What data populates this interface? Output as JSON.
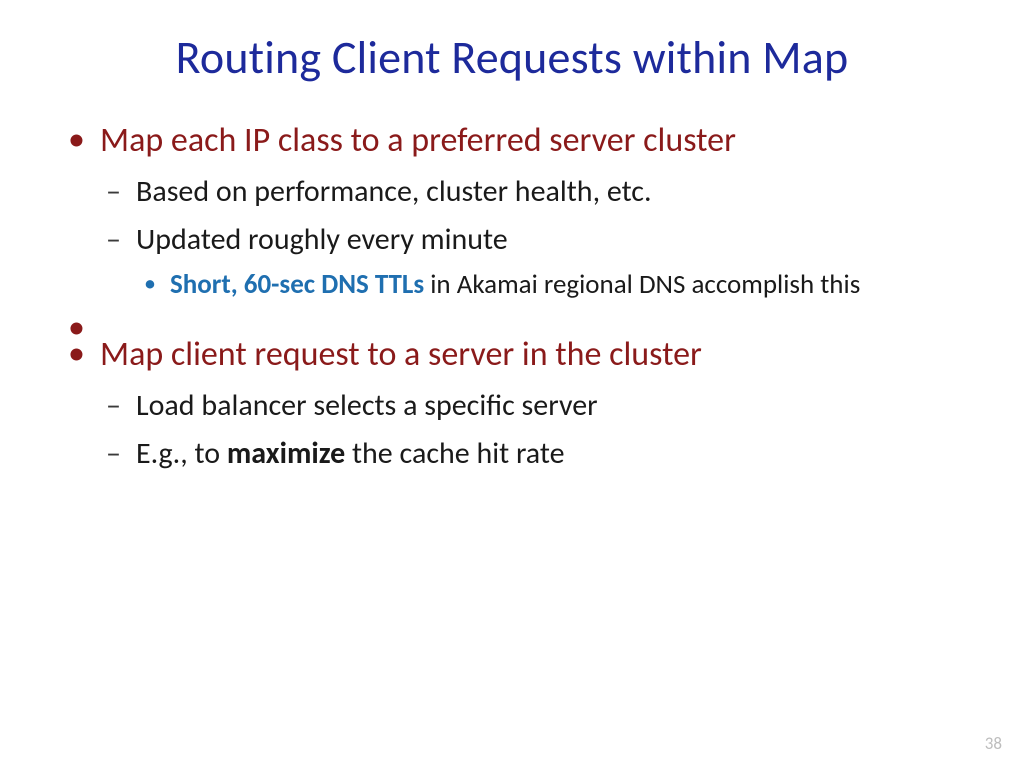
{
  "title": "Routing Client Requests within Map",
  "bullets": {
    "b1": {
      "text": "Map each IP class to a preferred server cluster",
      "sub": {
        "s1": "Based on performance, cluster health, etc.",
        "s2": "Updated roughly every minute",
        "s2sub": {
          "accent": "Short, 60-sec DNS TTLs",
          "rest": " in Akamai regional DNS accomplish this"
        }
      }
    },
    "b2": {
      "text": "Map client request to a server in the cluster",
      "sub": {
        "s1": "Load balancer selects a specific server",
        "s2": {
          "pre": "E.g., to ",
          "bold": "maximize",
          "post": " the cache hit rate"
        }
      }
    }
  },
  "page_number": "38"
}
